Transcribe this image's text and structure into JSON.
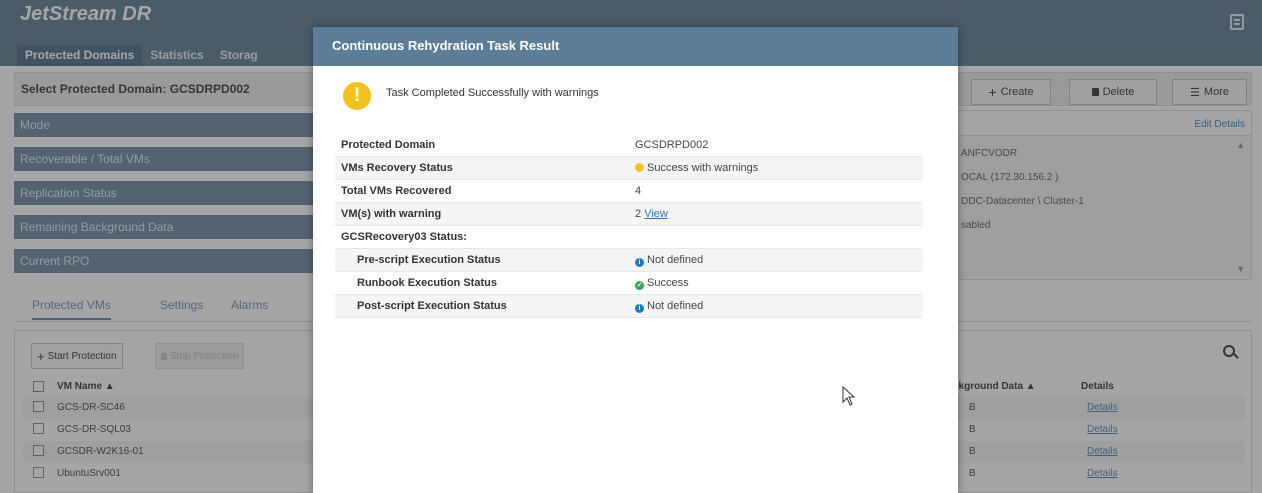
{
  "app": {
    "title": "JetStream DR",
    "tabs": [
      "Protected Domains",
      "Statistics",
      "Storag"
    ],
    "domain_label": "Select Protected Domain:  GCSDRPD002",
    "actions": {
      "create": "Create",
      "delete": "Delete",
      "more": "More"
    },
    "summary_rows": [
      "Mode",
      "Recoverable / Total VMs",
      "Replication Status",
      "Remaining Background Data",
      "Current RPO"
    ],
    "right_panel": {
      "links": "Edit  Details",
      "lines": [
        "ANFCVODR",
        "OCAL (172.30.156.2 )",
        "DDC-Datacenter \\ Cluster-1",
        "sabled"
      ]
    },
    "sub_tabs": [
      "Protected VMs",
      "Settings",
      "Alarms"
    ],
    "vm_toolbar": {
      "start": "Start Protection",
      "stop": "Stop Protection"
    },
    "vm_table": {
      "headers": {
        "name": "VM Name ▲",
        "bg_data": "ckground Data ▲",
        "details": "Details"
      },
      "rows": [
        {
          "name": "GCS-DR-SC46",
          "bg": "B",
          "details": "Details"
        },
        {
          "name": "GCS-DR-SQL03",
          "bg": "B",
          "details": "Details"
        },
        {
          "name": "GCSDR-W2K16-01",
          "bg": "B",
          "details": "Details"
        },
        {
          "name": "UbuntuSrv001",
          "bg": "B",
          "details": "Details"
        }
      ]
    }
  },
  "modal": {
    "title": "Continuous Rehydration Task Result",
    "status_message": "Task Completed Successfully with warnings",
    "rows": [
      {
        "label": "Protected Domain",
        "value": "GCSDRPD002"
      },
      {
        "label": "VMs Recovery Status",
        "value": "Success with warnings"
      },
      {
        "label": "Total VMs Recovered",
        "value": "4"
      },
      {
        "label": "VM(s) with warning",
        "count": "2",
        "link": "View"
      },
      {
        "label": "GCSRecovery03 Status:"
      },
      {
        "label": "Pre-script Execution Status",
        "value": "Not defined"
      },
      {
        "label": "Runbook Execution Status",
        "value": "Success"
      },
      {
        "label": "Post-script Execution Status",
        "value": "Not defined"
      }
    ]
  },
  "colors": {
    "header": "#5b7a93",
    "modal_header": "#5b7d98",
    "warning": "#f2c21a",
    "info": "#1f7bc0",
    "success": "#3aa64a",
    "link": "#2f72c0"
  }
}
